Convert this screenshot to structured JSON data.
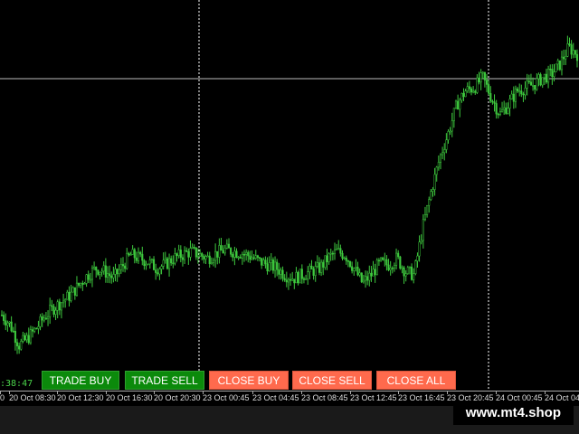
{
  "buttons": {
    "trade_buy": "TRADE BUY",
    "trade_sell": "TRADE SELL",
    "close_buy": "CLOSE BUY",
    "close_sell": "CLOSE SELL",
    "close_all": "CLOSE ALL"
  },
  "clock": ":38:47",
  "watermark": "www.mt4.shop",
  "time_axis": {
    "ticks": [
      "0",
      "20 Oct 08:30",
      "20 Oct 12:30",
      "20 Oct 16:30",
      "20 Oct 20:30",
      "23 Oct 00:45",
      "23 Oct 04:45",
      "23 Oct 08:45",
      "23 Oct 12:45",
      "23 Oct 16:45",
      "23 Oct 20:45",
      "24 Oct 00:45",
      "24 Oct 04:45",
      "24 Oct"
    ]
  },
  "colors": {
    "background": "#000000",
    "candle": "#3ec93e",
    "buy_button": "#0b8a0b",
    "close_button": "#ff6a4d",
    "grid_line": "#ffffff"
  },
  "chart_data": {
    "type": "line",
    "x_ticks": [
      "20 Oct 08:30",
      "20 Oct 12:30",
      "20 Oct 16:30",
      "20 Oct 20:30",
      "23 Oct 00:45",
      "23 Oct 04:45",
      "23 Oct 08:45",
      "23 Oct 12:45",
      "23 Oct 16:45",
      "23 Oct 20:45",
      "24 Oct 00:45",
      "24 Oct 04:45"
    ],
    "values": [
      0.36,
      0.3,
      0.18,
      0.22,
      0.28,
      0.35,
      0.4,
      0.44,
      0.48,
      0.54,
      0.6,
      0.64,
      0.62,
      0.58,
      0.65,
      0.72,
      0.7,
      0.68,
      0.64,
      0.66,
      0.7,
      0.72,
      0.74,
      0.72,
      0.7,
      0.73,
      0.75,
      0.74,
      0.73,
      0.71,
      0.68,
      0.66,
      0.64,
      0.6,
      0.58,
      0.6,
      0.62,
      0.64,
      0.7,
      0.74,
      0.72,
      0.64,
      0.55,
      0.6,
      0.67,
      0.66,
      0.7,
      0.62,
      0.6,
      0.88,
      1.1,
      1.3,
      1.45,
      1.62,
      1.7,
      1.72,
      1.78,
      1.66,
      1.56,
      1.62,
      1.7,
      1.72,
      1.74,
      1.78,
      1.8,
      1.86,
      1.96,
      1.92
    ],
    "vertical_grid_x": [
      "20 Oct 20:30",
      "24 Oct 00:45"
    ],
    "horizontal_line": true,
    "grid": false
  }
}
